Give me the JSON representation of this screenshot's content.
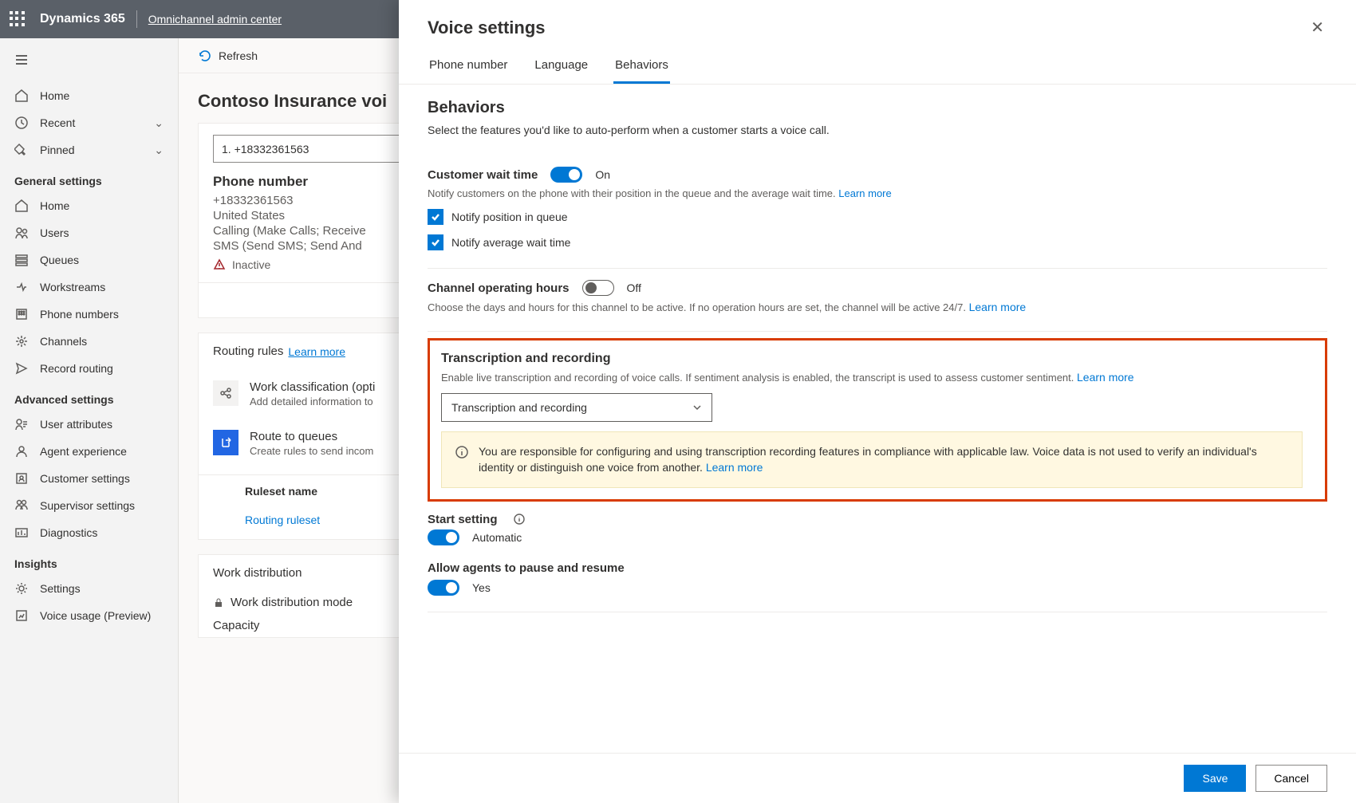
{
  "topbar": {
    "brand": "Dynamics 365",
    "subtitle": "Omnichannel admin center"
  },
  "nav": {
    "home": "Home",
    "recent": "Recent",
    "pinned": "Pinned",
    "general_heading": "General settings",
    "general": {
      "home": "Home",
      "users": "Users",
      "queues": "Queues",
      "workstreams": "Workstreams",
      "phone": "Phone numbers",
      "channels": "Channels",
      "routing": "Record routing"
    },
    "advanced_heading": "Advanced settings",
    "advanced": {
      "ua": "User attributes",
      "ae": "Agent experience",
      "cs": "Customer settings",
      "ss": "Supervisor settings",
      "diag": "Diagnostics"
    },
    "insights_heading": "Insights",
    "insights": {
      "settings": "Settings",
      "voice": "Voice usage (Preview)"
    }
  },
  "cmd": {
    "refresh": "Refresh"
  },
  "page": {
    "title": "Contoso Insurance voi"
  },
  "phonecard": {
    "input": "1. +18332361563",
    "heading": "Phone number",
    "number": "+18332361563",
    "country": "United States",
    "calling": "Calling (Make Calls; Receive",
    "sms": "SMS (Send SMS; Send And",
    "inactive": "Inactive"
  },
  "routing": {
    "title": "Routing rules",
    "learn": "Learn more",
    "wc_title": "Work classification (opti",
    "wc_desc": "Add detailed information to",
    "rq_title": "Route to queues",
    "rq_desc": "Create rules to send incom",
    "ruleset_header": "Ruleset name",
    "ruleset_link": "Routing ruleset"
  },
  "wd": {
    "title": "Work distribution",
    "mode": "Work distribution mode",
    "capacity": "Capacity"
  },
  "panel": {
    "title": "Voice settings",
    "tabs": {
      "phone": "Phone number",
      "lang": "Language",
      "behav": "Behaviors"
    },
    "behav_h": "Behaviors",
    "behav_sub": "Select the features you'd like to auto-perform when a customer starts a voice call.",
    "cwt": {
      "label": "Customer wait time",
      "state": "On",
      "desc": "Notify customers on the phone with their position in the queue and the average wait time. ",
      "learn": "Learn more",
      "c1": "Notify position in queue",
      "c2": "Notify average wait time"
    },
    "coh": {
      "label": "Channel operating hours",
      "state": "Off",
      "desc": "Choose the days and hours for this channel to be active. If no operation hours are set, the channel will be active 24/7. ",
      "learn": "Learn more"
    },
    "trans": {
      "label": "Transcription and recording",
      "desc": "Enable live transcription and recording of voice calls. If sentiment analysis is enabled, the transcript is used to assess customer sentiment. ",
      "learn": "Learn more",
      "dd": "Transcription and recording",
      "notice": "You are responsible for configuring and using transcription recording features in compliance with applicable law. Voice data is not used to verify an individual's identity or distinguish one voice from another. ",
      "notice_learn": "Learn more"
    },
    "start": {
      "label": "Start setting",
      "state": "Automatic"
    },
    "pause": {
      "label": "Allow agents to pause and resume",
      "state": "Yes"
    },
    "save": "Save",
    "cancel": "Cancel"
  }
}
